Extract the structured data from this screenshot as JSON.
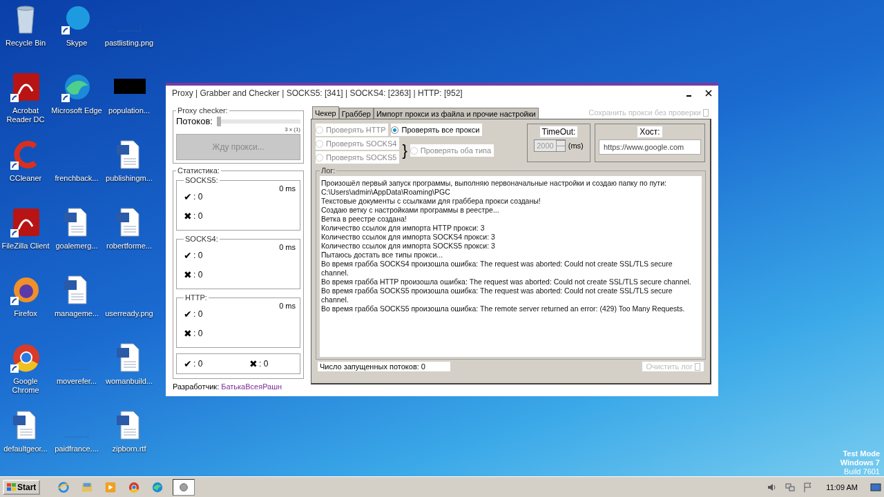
{
  "desktop": {
    "icons": [
      {
        "label": "Recycle Bin",
        "kind": "trash",
        "shortcut": false
      },
      {
        "label": "Skype",
        "kind": "bubble",
        "shortcut": true
      },
      {
        "label": "pastlisting.png",
        "kind": "blank",
        "shortcut": false
      },
      {
        "label": "Acrobat Reader DC",
        "kind": "red",
        "shortcut": true
      },
      {
        "label": "Microsoft Edge",
        "kind": "wave",
        "shortcut": true
      },
      {
        "label": "population...",
        "kind": "black",
        "shortcut": false
      },
      {
        "label": "CCleaner",
        "kind": "ring",
        "shortcut": true
      },
      {
        "label": "frenchback...",
        "kind": "blank",
        "shortcut": false
      },
      {
        "label": "publishingm...",
        "kind": "doc",
        "shortcut": false
      },
      {
        "label": "FileZilla Client",
        "kind": "red",
        "shortcut": true
      },
      {
        "label": "goalemerg...",
        "kind": "doc",
        "shortcut": false
      },
      {
        "label": "robertforme...",
        "kind": "doc",
        "shortcut": false
      },
      {
        "label": "Firefox",
        "kind": "fox",
        "shortcut": true
      },
      {
        "label": "manageme...",
        "kind": "doc",
        "shortcut": false
      },
      {
        "label": "userready.png",
        "kind": "blank",
        "shortcut": false
      },
      {
        "label": "Google Chrome",
        "kind": "browser",
        "shortcut": true
      },
      {
        "label": "moverefer...",
        "kind": "blank",
        "shortcut": false
      },
      {
        "label": "womanbuild...",
        "kind": "doc",
        "shortcut": false
      },
      {
        "label": "defaultgeor...",
        "kind": "doc",
        "shortcut": false
      },
      {
        "label": "paidfrance....",
        "kind": "blank",
        "shortcut": false
      },
      {
        "label": "zipborn.rtf",
        "kind": "doc",
        "shortcut": false
      }
    ],
    "os_text": [
      "Test Mode",
      "Windows 7",
      "Build 7601"
    ]
  },
  "window": {
    "title": "Proxy | Grabber and Checker | SOCKS5: [341] | SOCKS4: [2363] | HTTP: [952]",
    "checker": {
      "legend": "Proxy checker:",
      "threads_label": "Потоков:",
      "level": 0.0,
      "slider_reading": "3 x (1)",
      "button": "Жду прокси...",
      "button_disabled": true
    },
    "stats": {
      "legend": "Статистика:",
      "groups": [
        {
          "name": "SOCKS5:",
          "ms": "0 ms",
          "ok_mark": "✔",
          "ok": ": 0",
          "fail_mark": "✖",
          "fail": ": 0"
        },
        {
          "name": "SOCKS4:",
          "ms": "0 ms",
          "ok_mark": "✔",
          "ok": ": 0",
          "fail_mark": "✖",
          "fail": ": 0"
        },
        {
          "name": "HTTP:",
          "ms": "0 ms",
          "ok_mark": "✔",
          "ok": ": 0",
          "fail_mark": "✖",
          "fail": ": 0"
        }
      ],
      "total": {
        "ok_mark": "✔",
        "ok": ": 0",
        "fail_mark": "✖",
        "fail": ": 0"
      }
    },
    "developer": {
      "label": "Разработчик:",
      "link": "БатькаВсеяРашн"
    },
    "tabs": [
      {
        "label": "Чекер",
        "selected": true
      },
      {
        "label": "Граббер",
        "selected": false
      },
      {
        "label": "Импорт прокси из файла и прочие настройки",
        "selected": false
      }
    ],
    "save_option": {
      "label": "Сохранить прокси без проверки",
      "checked": false,
      "disabled": true
    },
    "radios": [
      {
        "label": "Проверять HTTP",
        "selected": false,
        "disabled": true
      },
      {
        "label": "Проверять все прокси",
        "selected": true,
        "disabled": false
      },
      {
        "label": "Проверять SOCKS4",
        "selected": false,
        "disabled": true
      },
      {
        "label": "Проверять SOCKS5",
        "selected": false,
        "disabled": true
      },
      {
        "label": "Проверять оба типа",
        "selected": false,
        "disabled": true
      }
    ],
    "brace": "}",
    "timeout": {
      "label": "TimeOut:",
      "value": "2000",
      "unit": "(ms)",
      "disabled": true
    },
    "host": {
      "label": "Хост:",
      "value": "https://www.google.com"
    },
    "log": {
      "legend": "Лог:",
      "lines": [
        "Произошёл первый запуск программы, выполняю первоначальные настройки и создаю папку по пути: C:\\Users\\admin\\AppData\\Roaming\\PGC",
        "Текстовые документы с ссылками для граббера прокси созданы!",
        "Создаю ветку с настройками программы в реестре...",
        "Ветка в реестре создана!",
        "Количество ссылок для импорта HTTP прокси: 3",
        "Количество ссылок для импорта SOCKS4 прокси: 3",
        "Количество ссылок для импорта SOCKS5 прокси: 3",
        "Пытаюсь достать все типы прокси...",
        "Во время грабба SOCKS4 произошла ошибка: The request was aborted: Could not create SSL/TLS secure channel.",
        "Во время грабба HTTP произошла ошибка: The request was aborted: Could not create SSL/TLS secure channel.",
        "Во время грабба SOCKS5 произошла ошибка: The request was aborted: Could not create SSL/TLS secure channel.",
        "Во время грабба SOCKS5 произошла ошибка: The remote server returned an error: (429) Too Many Requests."
      ]
    },
    "thread_count": "Число запущенных потоков: 0",
    "clear_button": {
      "label": "Очистить лог",
      "disabled": true
    }
  },
  "taskbar": {
    "start": "Start",
    "apps": [
      {
        "kind": "ie",
        "selected": false
      },
      {
        "kind": "folder",
        "selected": false
      },
      {
        "kind": "media",
        "selected": false
      },
      {
        "kind": "chrome",
        "selected": false
      },
      {
        "kind": "edge",
        "selected": false
      },
      {
        "kind": "app",
        "selected": true
      }
    ],
    "time": "11:09 AM"
  }
}
